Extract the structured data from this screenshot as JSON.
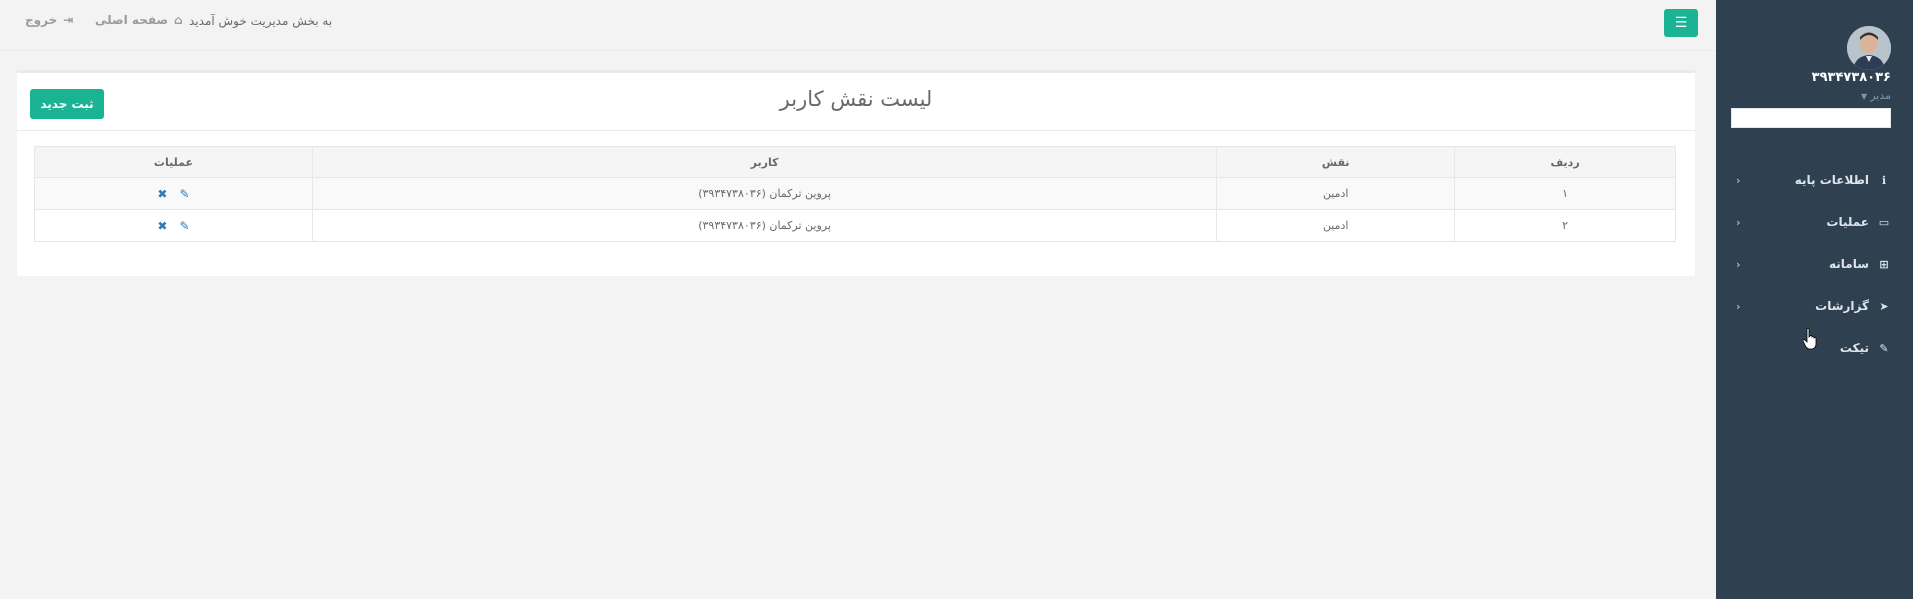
{
  "sidebar": {
    "username": "۳۹۳۴۷۳۸۰۳۶",
    "role": "مدیر",
    "search_placeholder": "",
    "items": [
      {
        "label": "اطلاعات پایه",
        "icon": "info-icon",
        "has_arrow": true
      },
      {
        "label": "عملیات",
        "icon": "inbox-icon",
        "has_arrow": true
      },
      {
        "label": "سامانه",
        "icon": "sitemap-icon",
        "has_arrow": true
      },
      {
        "label": "گزارشات",
        "icon": "paper-plane-icon",
        "has_arrow": true
      },
      {
        "label": "تیکت",
        "icon": "ticket-icon",
        "has_arrow": false
      }
    ]
  },
  "topbar": {
    "welcome": "به بخش مدیریت خوش آمدید",
    "home_label": "صفحه اصلی",
    "logout_label": "خروج"
  },
  "panel": {
    "title": "لیست نقش کاربر",
    "new_button": "ثبت جدید"
  },
  "table": {
    "headers": [
      "ردیف",
      "نقش",
      "کاربر",
      "عملیات"
    ],
    "rows": [
      {
        "index": "۱",
        "role": "ادمین",
        "user": "پروین ترکمان (۳۹۳۴۷۳۸۰۳۶)"
      },
      {
        "index": "۲",
        "role": "ادمین",
        "user": "پروین ترکمان (۳۹۳۴۷۳۸۰۳۶)"
      }
    ]
  },
  "colors": {
    "sidebar_bg": "#2f4050",
    "accent": "#1ab394",
    "page_bg": "#f3f3f3",
    "action_icon": "#337ab7"
  }
}
